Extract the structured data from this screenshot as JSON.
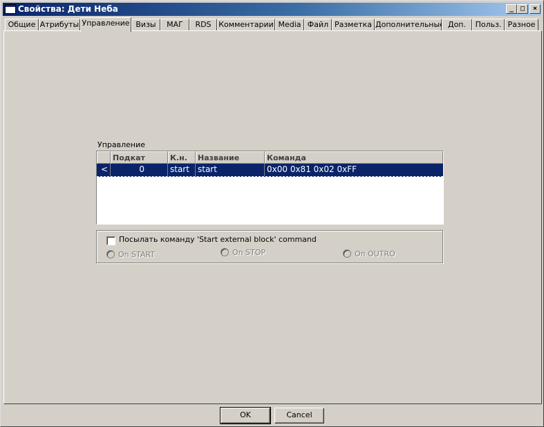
{
  "window": {
    "title": "Свойства: Дети Неба",
    "minimize": "_",
    "maximize": "□",
    "close": "×"
  },
  "tabs": [
    {
      "label": "Общие"
    },
    {
      "label": "Атрибуты"
    },
    {
      "label": "Управление",
      "active": true
    },
    {
      "label": "Визы"
    },
    {
      "label": "МАГ"
    },
    {
      "label": "RDS"
    },
    {
      "label": "Комментарии"
    },
    {
      "label": "Media"
    },
    {
      "label": "Файл"
    },
    {
      "label": "Разметка"
    },
    {
      "label": "Дополнительные"
    },
    {
      "label": "Доп."
    },
    {
      "label": "Польз."
    },
    {
      "label": "Разное"
    }
  ],
  "control": {
    "group_label": "Управление",
    "columns": [
      "",
      "Подкат",
      "К.н.",
      "Название",
      "Команда"
    ],
    "rows": [
      {
        "marker": "<",
        "subcat": "0",
        "kn": "start",
        "name": "start",
        "command": "0x00 0x81 0x02 0xFF"
      }
    ]
  },
  "options": {
    "send_command_label": "Посылать команду 'Start external block' command",
    "send_command_checked": false,
    "radios": [
      {
        "label": "On START"
      },
      {
        "label": "On STOP"
      },
      {
        "label": "On OUTRO"
      }
    ]
  },
  "buttons": {
    "ok": "OK",
    "cancel": "Cancel"
  },
  "colors": {
    "title_gradient_start": "#0a246a",
    "title_gradient_end": "#a6caf0",
    "selection": "#0a246a",
    "face": "#d4d0c8"
  }
}
